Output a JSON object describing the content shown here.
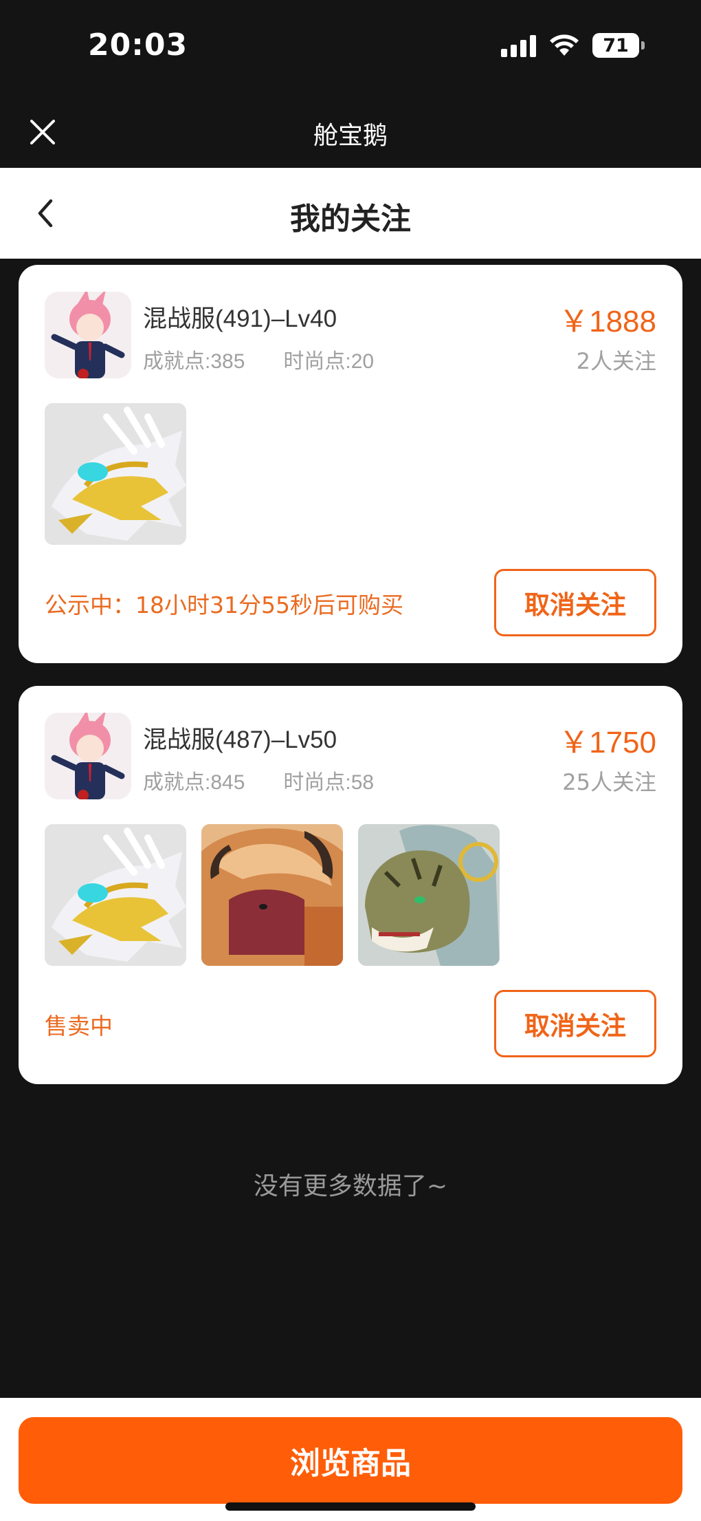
{
  "status_bar": {
    "time": "20:03",
    "battery": "71"
  },
  "app": {
    "title": "舱宝鹅"
  },
  "nav": {
    "title": "我的关注"
  },
  "cards": [
    {
      "server": "混战服(491)–Lv40",
      "achievement": "成就点:385",
      "fashion": "时尚点:20",
      "price": "￥1888",
      "followers": "2人关注",
      "status": "公示中：18小时31分55秒后可购买",
      "unfollow_label": "取消关注",
      "pets": [
        "dragon-icon"
      ]
    },
    {
      "server": "混战服(487)–Lv50",
      "achievement": "成就点:845",
      "fashion": "时尚点:58",
      "price": "￥1750",
      "followers": "25人关注",
      "status": "售卖中",
      "unfollow_label": "取消关注",
      "pets": [
        "dragon-icon",
        "bull-icon",
        "tiger-icon"
      ]
    }
  ],
  "end_text": "没有更多数据了~",
  "bottom": {
    "browse_label": "浏览商品"
  },
  "colors": {
    "accent": "#f06418",
    "button": "#ff5d08",
    "background": "#141414"
  }
}
